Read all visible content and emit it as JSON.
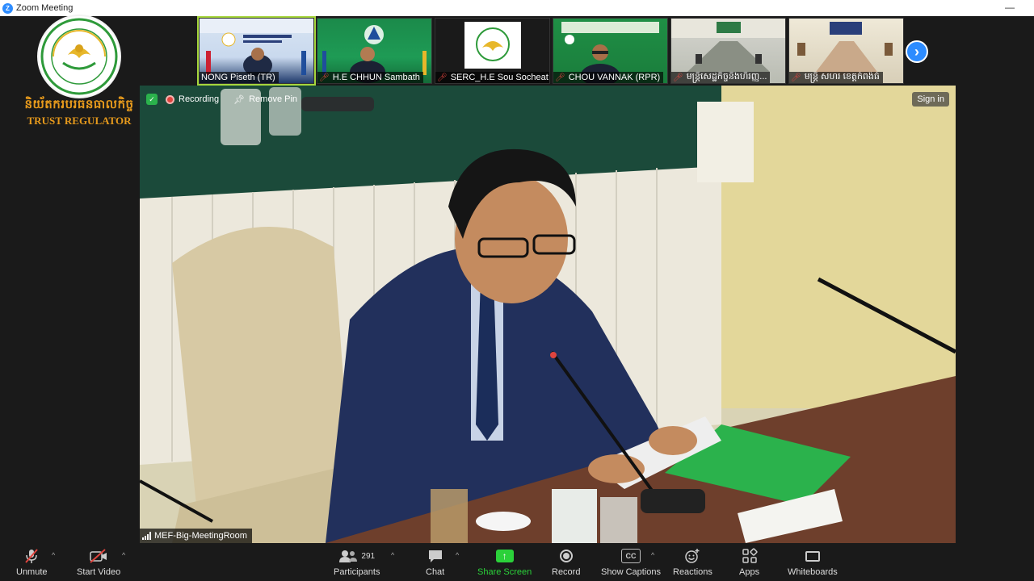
{
  "window": {
    "title": "Zoom Meeting",
    "minimize": "—"
  },
  "logo": {
    "khmer_text": "និយ័តករបរធនធាលកិច្ច",
    "english_text": "TRUST REGULATOR"
  },
  "participants_strip": [
    {
      "name": "NONG Piseth (TR)",
      "muted": false,
      "active": true
    },
    {
      "name": "H.E CHHUN Sambath",
      "muted": true,
      "active": false
    },
    {
      "name": "SERC_H.E Sou Socheat",
      "muted": true,
      "active": false
    },
    {
      "name": "CHOU VANNAK (RPR)",
      "muted": true,
      "active": false
    },
    {
      "name": "មន្ត្រីសេដ្ឋកិច្ចនិងហិរញ្ញ...",
      "muted": true,
      "active": false
    },
    {
      "name": "មន្ត្រី សហរ ខេត្តកំពង់ធំ",
      "muted": true,
      "active": false
    }
  ],
  "main_video": {
    "recording_label": "Recording",
    "remove_pin_label": "Remove Pin",
    "sign_in_label": "Sign in",
    "room_name": "MEF-Big-MeetingRoom"
  },
  "toolbar": {
    "unmute": "Unmute",
    "start_video": "Start Video",
    "participants": "Participants",
    "participants_count": "291",
    "chat": "Chat",
    "share_screen": "Share Screen",
    "record": "Record",
    "show_captions": "Show Captions",
    "cc": "CC",
    "reactions": "Reactions",
    "apps": "Apps",
    "whiteboards": "Whiteboards"
  },
  "colors": {
    "zoom_blue": "#2D8CFF",
    "share_green": "#2bd13a",
    "mute_red": "#e0443e",
    "logo_gold": "#e79a1c"
  }
}
